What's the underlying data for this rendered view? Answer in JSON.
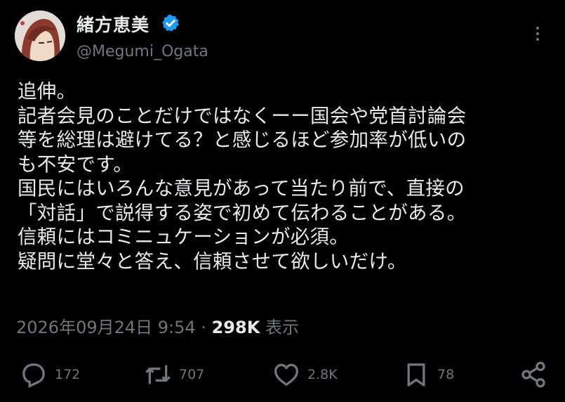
{
  "author": {
    "display_name": "緒方恵美",
    "handle": "@Megumi_Ogata",
    "verified_color": "#1d9bf0"
  },
  "tweet": {
    "lines": [
      "追伸。",
      "記者会見のことだけではなくーー国会や党首討論会",
      "等を総理は避けてる？と感じるほど参加率が低いの",
      "も不安です。",
      "国民にはいろんな意見があって当たり前で、直接の",
      "「対話」で説得する姿で初めて伝わることがある。",
      "信頼にはコミニュケーションが必須。",
      "疑問に堂々と答え、信頼させて欲しいだけ。"
    ]
  },
  "meta": {
    "timestamp": "2026年09月24日 9:54",
    "separator": "·",
    "views": "298K",
    "views_label": "表示"
  },
  "actions": {
    "replies": "172",
    "reposts": "707",
    "likes": "2.8K",
    "bookmarks": "78"
  },
  "icons": {
    "reply": "reply-icon",
    "repost": "repost-icon",
    "like": "heart-icon",
    "bookmark": "bookmark-icon",
    "share": "share-icon",
    "more": "more-icon",
    "verified": "verified-badge-icon"
  }
}
